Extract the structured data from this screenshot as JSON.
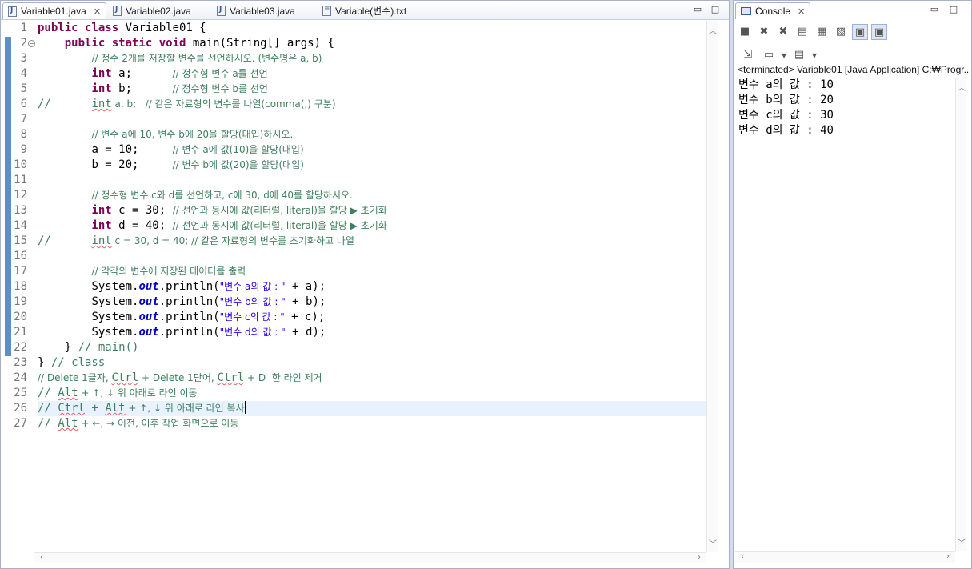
{
  "editor": {
    "tabs": [
      {
        "label": "Variable01.java",
        "active": true
      },
      {
        "label": "Variable02.java"
      },
      {
        "label": "Variable03.java"
      },
      {
        "label": "Variable(변수).txt"
      }
    ],
    "line_numbers": [
      "1",
      "2",
      "3",
      "4",
      "5",
      "6",
      "7",
      "8",
      "9",
      "10",
      "11",
      "12",
      "13",
      "14",
      "15",
      "16",
      "17",
      "18",
      "19",
      "20",
      "21",
      "22",
      "23",
      "24",
      "25",
      "26",
      "27"
    ],
    "code": {
      "l1_kw": "public class",
      "l1_rest": " Variable01 {",
      "l2_kw": "public static void",
      "l2_rest": " main(String[] args) {",
      "l3_cm": "// 정수 2개를 저장할 변수를 선언하시오. (변수명은 a, b)",
      "l4_kw": "int",
      "l4_rest": " a;      ",
      "l4_cm": "// 정수형 변수 a를 선언",
      "l5_kw": "int",
      "l5_rest": " b;      ",
      "l5_cm": "// 정수형 변수 b를 선언",
      "l6_pre": "//      ",
      "l6_sq": "int",
      "l6_rest": " a, b;   // 같은 자료형의 변수를 나열(comma(,) 구분)",
      "l8_cm": "// 변수 a에 10, 변수 b에 20을 할당(대입)하시오.",
      "l9_code": "a = 10;     ",
      "l9_cm": "// 변수 a에 값(10)을 할당(대입)",
      "l10_code": "b = 20;     ",
      "l10_cm": "// 변수 b에 값(20)을 할당(대입)",
      "l12_cm": "// 정수형 변수 c와 d를 선언하고, c에 30, d에 40를 할당하시오.",
      "l13_kw": "int",
      "l13_rest": " c = 30; ",
      "l13_cm": "// 선언과 동시에 값(리터럴, literal)을 할당 ▶ 초기화",
      "l14_kw": "int",
      "l14_rest": " d = 40; ",
      "l14_cm": "// 선언과 동시에 값(리터럴, literal)을 할당 ▶ 초기화",
      "l15_pre": "//      ",
      "l15_sq": "int",
      "l15_rest": " c = 30, d = 40; // 같은 자료형의 변수를 초기화하고 나열",
      "l17_cm": "// 각각의 변수에 저장된 데이터를 출력",
      "sys": "System.",
      "out": "out",
      "println": ".println(",
      "l18_str": "\"변수 a의 값 : \"",
      "l18_end": " + a);",
      "l19_str": "\"변수 b의 값 : \"",
      "l19_end": " + b);",
      "l20_str": "\"변수 c의 값 : \"",
      "l20_end": " + c);",
      "l21_str": "\"변수 d의 값 : \"",
      "l21_end": " + d);",
      "l22_code": "} ",
      "l22_cm": "// main()",
      "l23_code": "} ",
      "l23_cm": "// class",
      "l24_a": "// Delete 1글자, ",
      "l24_sq1": "Ctrl",
      "l24_b": " + Delete 1단어, ",
      "l24_sq2": "Ctrl",
      "l24_c": " + D  한 라인 제거",
      "l25_a": "// ",
      "l25_sq": "Alt",
      "l25_b": " + ↑, ↓ 위 아래로 라인 이동",
      "l26_a": "// ",
      "l26_sq1": "Ctrl",
      "l26_b": " + ",
      "l26_sq2": "Alt",
      "l26_c": " + ↑, ↓ 위 아래로 라인 복사",
      "l27_a": "// ",
      "l27_sq": "Alt",
      "l27_b": " + ←, → 이전, 이후 작업 화면으로 이동"
    }
  },
  "console": {
    "tab_label": "Console",
    "status": "<terminated> Variable01 [Java Application] C:₩Progr...",
    "output": [
      "변수 a의 값 : 10",
      "변수 b의 값 : 20",
      "변수 c의 값 : 30",
      "변수 d의 값 : 40"
    ]
  }
}
